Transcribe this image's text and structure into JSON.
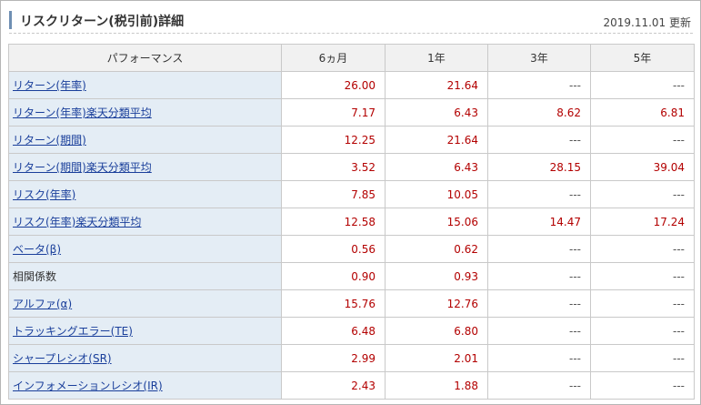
{
  "header": {
    "title": "リスクリターン(税引前)詳細",
    "updated": "2019.11.01 更新"
  },
  "colors": {
    "value": "#b30000",
    "link": "#1a3f9b",
    "label_bg": "#e4edf5",
    "header_bg": "#f1f1f1",
    "accent_bar": "#6f8fb3"
  },
  "table": {
    "columns": [
      "パフォーマンス",
      "6ヵ月",
      "1年",
      "3年",
      "5年"
    ],
    "rows": [
      {
        "label": "リターン(年率)",
        "link": true,
        "values": [
          "26.00",
          "21.64",
          "---",
          "---"
        ]
      },
      {
        "label": "リターン(年率)楽天分類平均",
        "link": true,
        "values": [
          "7.17",
          "6.43",
          "8.62",
          "6.81"
        ]
      },
      {
        "label": "リターン(期間)",
        "link": true,
        "values": [
          "12.25",
          "21.64",
          "---",
          "---"
        ]
      },
      {
        "label": "リターン(期間)楽天分類平均",
        "link": true,
        "values": [
          "3.52",
          "6.43",
          "28.15",
          "39.04"
        ]
      },
      {
        "label": "リスク(年率)",
        "link": true,
        "values": [
          "7.85",
          "10.05",
          "---",
          "---"
        ]
      },
      {
        "label": "リスク(年率)楽天分類平均",
        "link": true,
        "values": [
          "12.58",
          "15.06",
          "14.47",
          "17.24"
        ]
      },
      {
        "label": "ベータ(β)",
        "link": true,
        "values": [
          "0.56",
          "0.62",
          "---",
          "---"
        ]
      },
      {
        "label": "相関係数",
        "link": false,
        "values": [
          "0.90",
          "0.93",
          "---",
          "---"
        ]
      },
      {
        "label": "アルファ(α)",
        "link": true,
        "values": [
          "15.76",
          "12.76",
          "---",
          "---"
        ]
      },
      {
        "label": "トラッキングエラー(TE)",
        "link": true,
        "values": [
          "6.48",
          "6.80",
          "---",
          "---"
        ]
      },
      {
        "label": "シャープレシオ(SR)",
        "link": true,
        "values": [
          "2.99",
          "2.01",
          "---",
          "---"
        ]
      },
      {
        "label": "インフォメーションレシオ(IR)",
        "link": true,
        "values": [
          "2.43",
          "1.88",
          "---",
          "---"
        ]
      }
    ]
  }
}
